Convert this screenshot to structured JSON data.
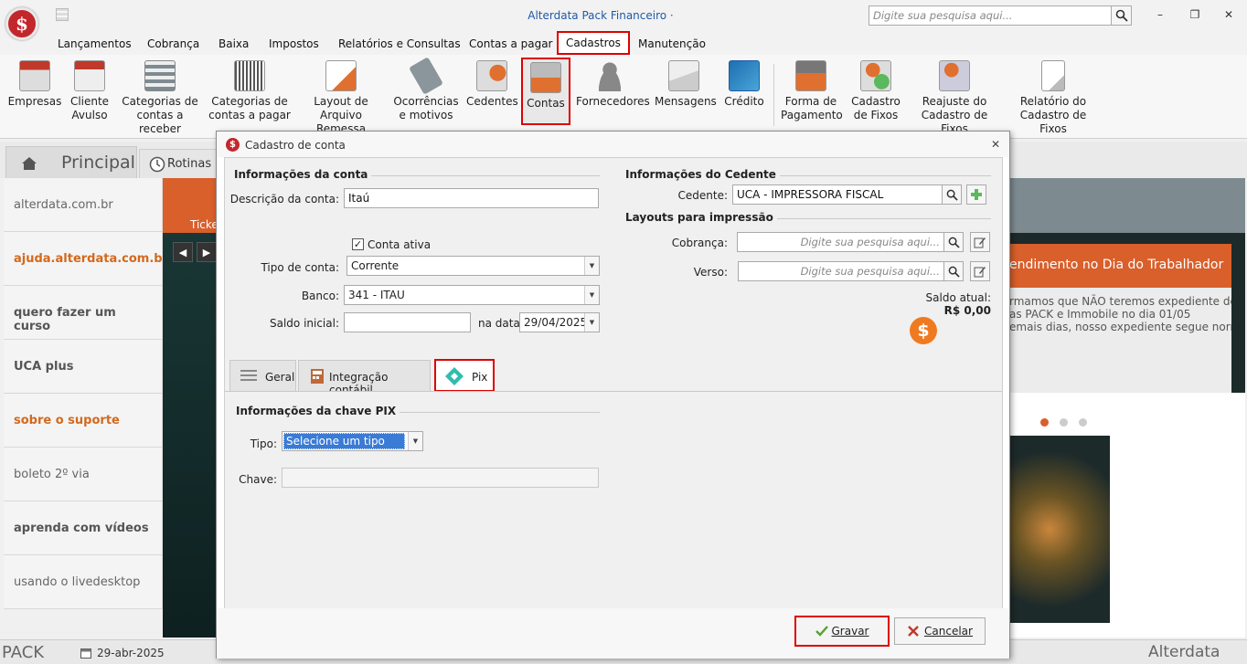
{
  "app": {
    "title": "Alterdata Pack Financeiro ·",
    "search_placeholder": "Digite sua pesquisa aqui...",
    "logo_glyph": "$"
  },
  "menu": [
    "Lançamentos",
    "Cobrança",
    "Baixa",
    "Impostos",
    "Relatórios e Consultas",
    "Contas a pagar",
    "Cadastros",
    "Manutenção"
  ],
  "ribbon": [
    {
      "label1": "Empresas",
      "label2": ""
    },
    {
      "label1": "Cliente",
      "label2": "Avulso"
    },
    {
      "label1": "Categorias de",
      "label2": "contas a receber"
    },
    {
      "label1": "Categorias de",
      "label2": "contas a pagar"
    },
    {
      "label1": "Layout de",
      "label2": "Arquivo Remessa"
    },
    {
      "label1": "Ocorrências",
      "label2": "e motivos"
    },
    {
      "label1": "Cedentes",
      "label2": ""
    },
    {
      "label1": "Contas",
      "label2": ""
    },
    {
      "label1": "Fornecedores",
      "label2": ""
    },
    {
      "label1": "Mensagens",
      "label2": ""
    },
    {
      "label1": "Crédito",
      "label2": ""
    },
    {
      "label1": "Forma de",
      "label2": "Pagamento"
    },
    {
      "label1": "Cadastro",
      "label2": "de Fixos"
    },
    {
      "label1": "Reajuste do",
      "label2": "Cadastro de Fixos"
    },
    {
      "label1": "Relatório do",
      "label2": "Cadastro de Fixos"
    }
  ],
  "tabs": {
    "home": "Principal",
    "routines": "Rotinas aut"
  },
  "sidebar": [
    "alterdata.com.br",
    "ajuda.alterdata.com.br",
    "quero fazer um curso",
    "UCA plus",
    "sobre o suporte",
    "boleto 2º via",
    "aprenda com vídeos",
    "usando o livedesktop"
  ],
  "content": {
    "ticket": "Ticke",
    "news_title": "endimento no Dia do Trabalhador",
    "news_lines": [
      "rmamos que NÃO teremos expediente de",
      "as PACK e Immobile no dia 01/05",
      "emais dias, nosso expediente segue normal."
    ]
  },
  "statusbar": {
    "pack": "PACK",
    "date": "29-abr-2025",
    "brand": "Alterdata"
  },
  "dialog": {
    "title": "Cadastro de conta",
    "sec_conta": "Informações da conta",
    "desc_label": "Descrição da conta:",
    "desc_value": "Itaú",
    "ativa_label": "Conta ativa",
    "ativa_mark": "✓",
    "tipo_label": "Tipo de conta:",
    "tipo_value": "Corrente",
    "banco_label": "Banco:",
    "banco_value": "341 - ITAU",
    "saldo_label": "Saldo inicial:",
    "saldo_value": "",
    "data_label": "na data",
    "data_value": "29/04/2025",
    "sec_cedente": "Informações do Cedente",
    "cedente_label": "Cedente:",
    "cedente_value": "UCA - IMPRESSORA FISCAL",
    "sec_layouts": "Layouts para impressão",
    "cobranca_label": "Cobrança:",
    "verso_label": "Verso:",
    "layout_placeholder": "Digite sua pesquisa aqui...",
    "saldo_atual_label": "Saldo atual:",
    "saldo_atual_value": "R$ 0,00",
    "tabs": [
      "Geral",
      "Integração contábil",
      "Pix"
    ],
    "sec_pix": "Informações da chave PIX",
    "pix_tipo_label": "Tipo:",
    "pix_tipo_value": "Selecione um tipo",
    "pix_chave_label": "Chave:",
    "pix_chave_value": "",
    "save": "Gravar",
    "cancel": "Cancelar"
  },
  "colors": {
    "accent_red": "#c3272b",
    "highlight": "#dd0000",
    "orange": "#d95f2b",
    "title_blue": "#1e5aa8"
  }
}
